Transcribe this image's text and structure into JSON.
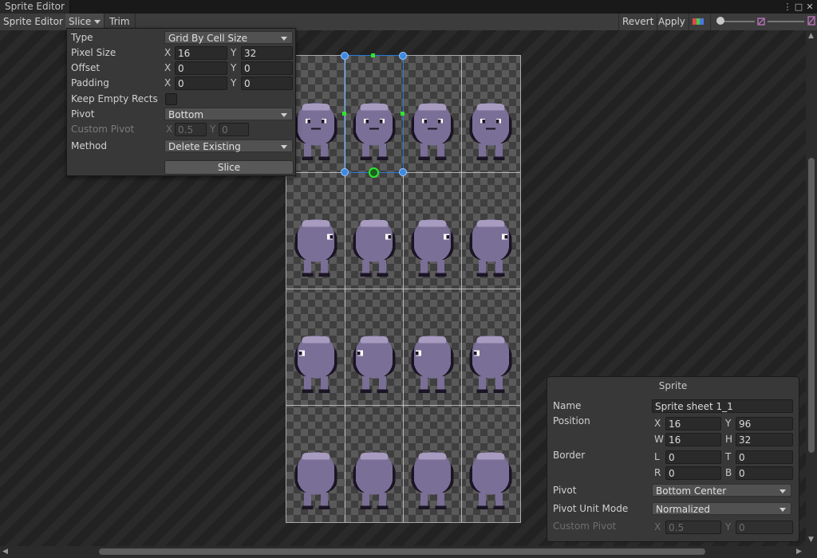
{
  "window": {
    "tab_title": "Sprite Editor",
    "controls": [
      "⋮",
      "□",
      "✕"
    ]
  },
  "toolbar": {
    "editor_menu": "Sprite Editor",
    "slice": "Slice",
    "trim": "Trim",
    "revert": "Revert",
    "apply": "Apply"
  },
  "slice_popup": {
    "type_label": "Type",
    "type_value": "Grid By Cell Size",
    "pixel_size_label": "Pixel Size",
    "pixel_size_x": "16",
    "pixel_size_y": "32",
    "offset_label": "Offset",
    "offset_x": "0",
    "offset_y": "0",
    "padding_label": "Padding",
    "padding_x": "0",
    "padding_y": "0",
    "keep_empty_label": "Keep Empty Rects",
    "pivot_label": "Pivot",
    "pivot_value": "Bottom",
    "custom_pivot_label": "Custom Pivot",
    "custom_pivot_x": "0.5",
    "custom_pivot_y": "0",
    "method_label": "Method",
    "method_value": "Delete Existing",
    "slice_button": "Slice",
    "x": "X",
    "y": "Y"
  },
  "sprite_panel": {
    "title": "Sprite",
    "name_label": "Name",
    "name_value": "Sprite sheet 1_1",
    "position_label": "Position",
    "x": "X",
    "y": "Y",
    "w": "W",
    "h": "H",
    "pos_x": "16",
    "pos_y": "96",
    "pos_w": "16",
    "pos_h": "32",
    "border_label": "Border",
    "l": "L",
    "t": "T",
    "r": "R",
    "b": "B",
    "border_l": "0",
    "border_t": "0",
    "border_r": "0",
    "border_b": "0",
    "pivot_label": "Pivot",
    "pivot_value": "Bottom Center",
    "pivot_unit_label": "Pivot Unit Mode",
    "pivot_unit_value": "Normalized",
    "custom_pivot_label": "Custom Pivot",
    "custom_pivot_x": "0.5",
    "custom_pivot_y": "0"
  },
  "colors": {
    "sprite_body": "#7a6f96",
    "sprite_light": "#a79bbf",
    "sprite_outline": "#1b1424",
    "selection": "#2b7bd6",
    "handle_green": "#2ee62e"
  }
}
